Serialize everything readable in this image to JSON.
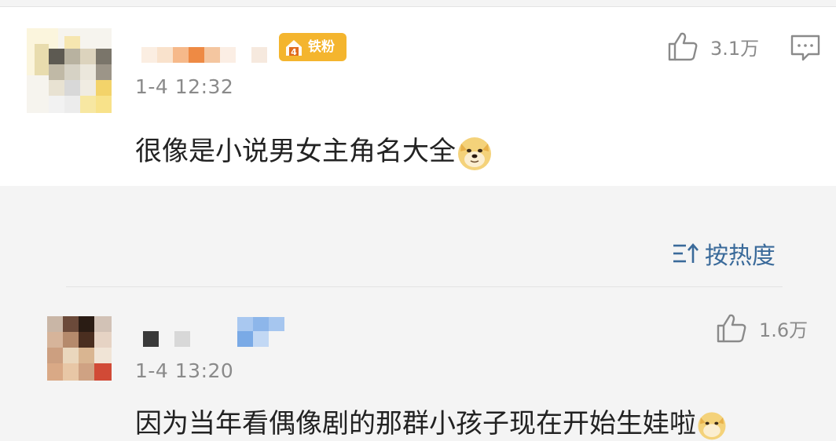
{
  "comment": {
    "badge_label": "铁粉",
    "badge_level": "4",
    "timestamp": "1-4 12:32",
    "text": "很像是小说男女主角名大全",
    "emoji": "doge-emoji",
    "like_count": "3.1万",
    "like_icon": "thumbs-up-icon",
    "reply_icon": "comment-icon"
  },
  "sort": {
    "label": "按热度",
    "icon": "sort-icon"
  },
  "reply": {
    "timestamp": "1-4 13:20",
    "text": "因为当年看偶像剧的那群小孩子现在开始生娃啦",
    "emoji": "doge-emoji",
    "like_count": "1.6万",
    "like_icon": "thumbs-up-icon"
  },
  "colors": {
    "badge": "#f4b52e",
    "sort_link": "#3a6a9a",
    "meta_text": "#8a8a8a"
  }
}
